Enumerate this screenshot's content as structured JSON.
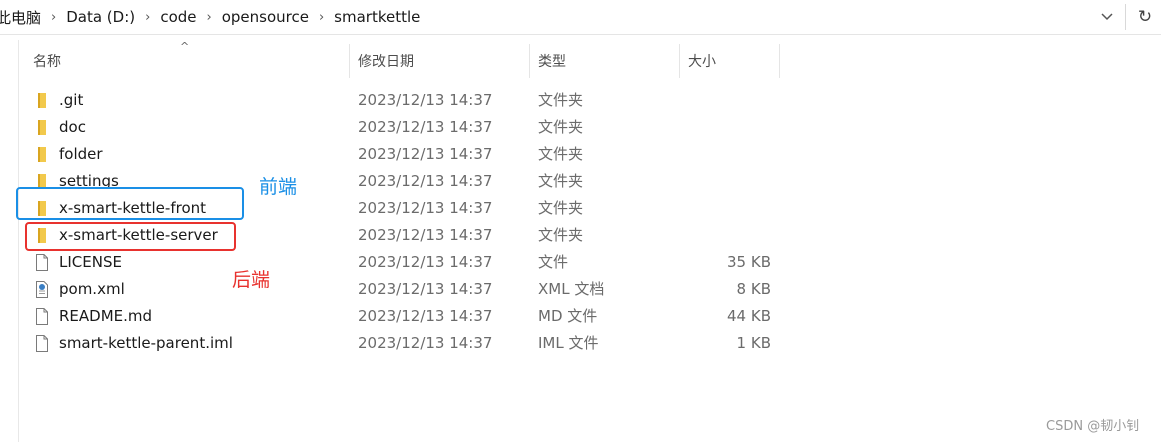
{
  "breadcrumb": [
    "此电脑",
    "Data (D:)",
    "code",
    "opensource",
    "smartkettle"
  ],
  "toolbar": {
    "dropdown_icon": "chevron-down-icon",
    "refresh_icon": "refresh-icon",
    "refresh_glyph": "↻"
  },
  "columns": {
    "name": "名称",
    "date": "修改日期",
    "type": "类型",
    "size": "大小"
  },
  "files": [
    {
      "name": ".git",
      "date": "2023/12/13 14:37",
      "type": "文件夹",
      "size": "",
      "icon": "folder-icon"
    },
    {
      "name": "doc",
      "date": "2023/12/13 14:37",
      "type": "文件夹",
      "size": "",
      "icon": "folder-icon"
    },
    {
      "name": "folder",
      "date": "2023/12/13 14:37",
      "type": "文件夹",
      "size": "",
      "icon": "folder-icon"
    },
    {
      "name": "settings",
      "date": "2023/12/13 14:37",
      "type": "文件夹",
      "size": "",
      "icon": "folder-icon"
    },
    {
      "name": "x-smart-kettle-front",
      "date": "2023/12/13 14:37",
      "type": "文件夹",
      "size": "",
      "icon": "folder-icon"
    },
    {
      "name": "x-smart-kettle-server",
      "date": "2023/12/13 14:37",
      "type": "文件夹",
      "size": "",
      "icon": "folder-icon"
    },
    {
      "name": "LICENSE",
      "date": "2023/12/13 14:37",
      "type": "文件",
      "size": "35 KB",
      "icon": "file-icon"
    },
    {
      "name": "pom.xml",
      "date": "2023/12/13 14:37",
      "type": "XML 文档",
      "size": "8 KB",
      "icon": "xml-file-icon"
    },
    {
      "name": "README.md",
      "date": "2023/12/13 14:37",
      "type": "MD 文件",
      "size": "44 KB",
      "icon": "file-icon"
    },
    {
      "name": "smart-kettle-parent.iml",
      "date": "2023/12/13 14:37",
      "type": "IML 文件",
      "size": "1 KB",
      "icon": "file-icon"
    }
  ],
  "annotations": {
    "front_label": "前端",
    "server_label": "后端",
    "front_color": "#1a8fe6",
    "server_color": "#e8322e"
  },
  "colors": {
    "folder": "#f2c94c",
    "folder_dark": "#d9a520"
  },
  "watermark": "CSDN @韧小钊"
}
